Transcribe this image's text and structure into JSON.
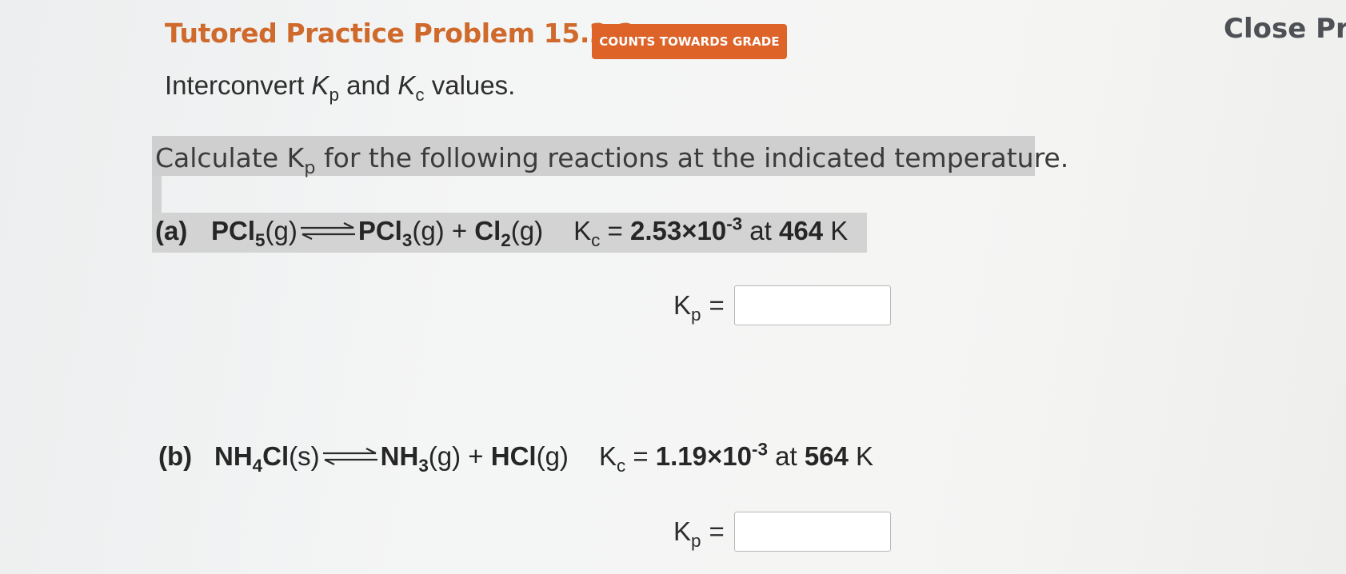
{
  "header": {
    "title": "Tutored Practice Problem 15.2.2",
    "badge": "COUNTS TOWARDS GRADE",
    "close_label": "Close Pro"
  },
  "subtitle": {
    "prefix": "Interconvert ",
    "k1": "K",
    "k1_sub": "p",
    "mid": " and ",
    "k2": "K",
    "k2_sub": "c",
    "suffix": " values."
  },
  "instruction": {
    "prefix": "Calculate K",
    "sub": "p",
    "suffix": " for the following reactions at the indicated temperature."
  },
  "parts": {
    "a": {
      "label": "(a)",
      "reactant": "PCl",
      "reactant_sub": "5",
      "reactant_state": "(g)",
      "product1": "PCl",
      "product1_sub": "3",
      "product1_state": "(g)",
      "plus": " + ",
      "product2": "Cl",
      "product2_sub": "2",
      "product2_state": "(g)",
      "k_symbol": "K",
      "k_sub": "c",
      "equals": " = ",
      "k_mantissa": "2.53×10",
      "k_exponent": "-3",
      "at": " at ",
      "temp_value": "464",
      "temp_unit": " K",
      "answer_label": "K",
      "answer_sub": "p",
      "answer_eq": "=",
      "answer_value": ""
    },
    "b": {
      "label": "(b)",
      "reactant": "NH",
      "reactant_sub": "4",
      "reactant_tail": "Cl",
      "reactant_state": "(s)",
      "product1": "NH",
      "product1_sub": "3",
      "product1_state": "(g)",
      "plus": " + ",
      "product2": "HCl",
      "product2_state": "(g)",
      "k_symbol": "K",
      "k_sub": "c",
      "equals": " = ",
      "k_mantissa": "1.19×10",
      "k_exponent": "-3",
      "at": " at ",
      "temp_value": "564",
      "temp_unit": " K",
      "answer_label": "K",
      "answer_sub": "p",
      "answer_eq": "=",
      "answer_value": ""
    }
  },
  "colors": {
    "title": "#cf6a2c",
    "badge_bg": "#dd6329",
    "badge_text": "#ffffff",
    "highlight": "#d3d3d3",
    "close_text": "#4d5054"
  },
  "icons": {
    "equilibrium": "equilibrium-arrow-icon"
  }
}
